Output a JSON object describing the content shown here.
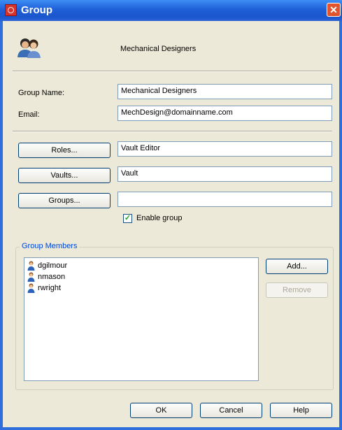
{
  "window": {
    "title": "Group",
    "close_glyph": "✕"
  },
  "header": {
    "group_name": "Mechanical Designers",
    "icon": "group-icon"
  },
  "form": {
    "group_name_label": "Group Name:",
    "group_name_value": "Mechanical Designers",
    "email_label": "Email:",
    "email_value": "MechDesign@domainname.com"
  },
  "assignments": {
    "roles_button": "Roles...",
    "roles_value": "Vault Editor",
    "vaults_button": "Vaults...",
    "vaults_value": "Vault",
    "groups_button": "Groups...",
    "groups_value": ""
  },
  "enable_group": {
    "label": "Enable group",
    "checked": true
  },
  "members": {
    "legend": "Group Members",
    "items": [
      "dgilmour",
      "nmason",
      "rwright"
    ],
    "add_button": "Add...",
    "remove_button": "Remove"
  },
  "footer": {
    "ok": "OK",
    "cancel": "Cancel",
    "help": "Help"
  },
  "colors": {
    "titlebar": "#1f5fd8",
    "dialog_bg": "#ece9d8",
    "close": "#e0552e",
    "legend": "#0046d5"
  }
}
